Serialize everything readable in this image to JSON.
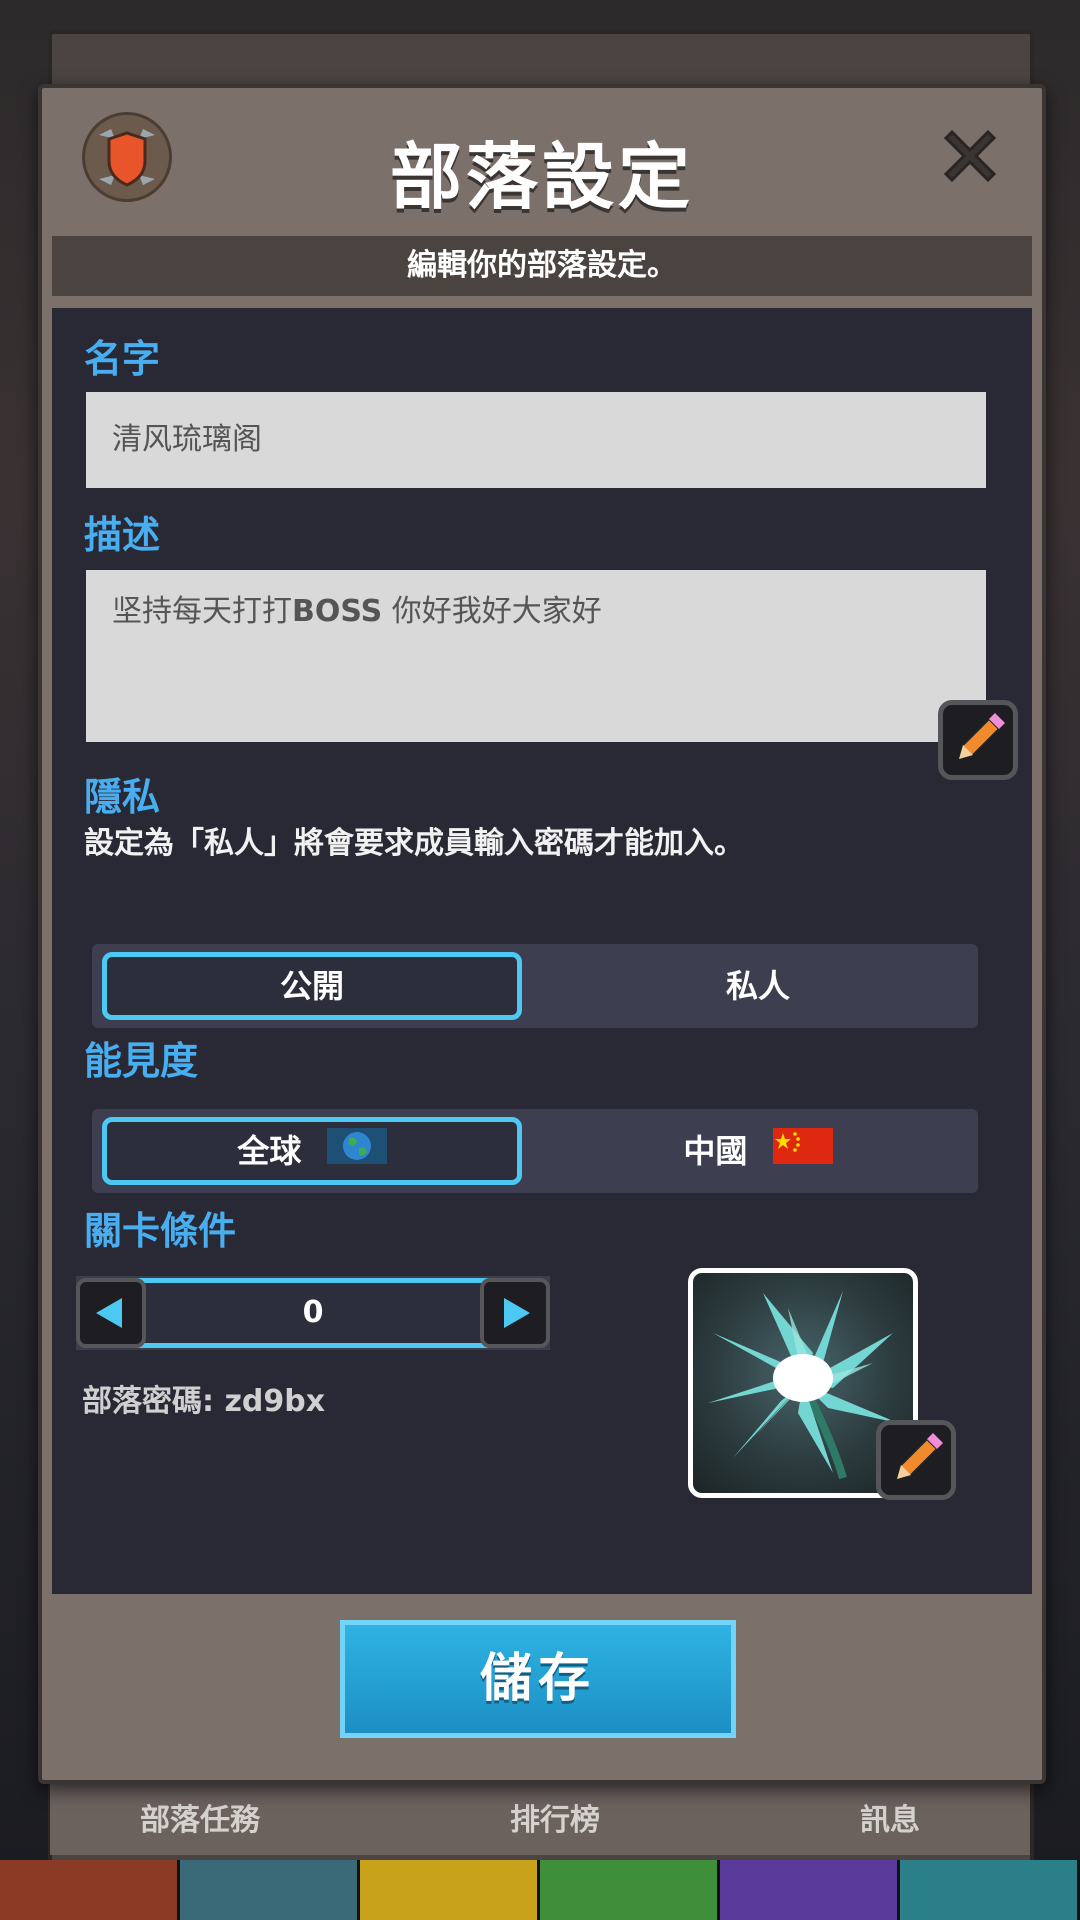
{
  "dialog": {
    "title": "部落設定",
    "subtitle": "編輯你的部落設定。",
    "icons": {
      "badge": "shield-icon",
      "close": "close-icon"
    }
  },
  "name_section": {
    "label": "名字",
    "value": "清风琉璃阁"
  },
  "description_section": {
    "label": "描述",
    "value_prefix": "坚持每天打打",
    "value_bold": "BOSS",
    "value_suffix": " 你好我好大家好",
    "edit_icon": "pencil-icon"
  },
  "privacy_section": {
    "label": "隱私",
    "note": "設定為「私人」將會要求成員輸入密碼才能加入。",
    "options": [
      "公開",
      "私人"
    ],
    "selected": "公開"
  },
  "visibility_section": {
    "label": "能見度",
    "options": [
      {
        "label": "全球",
        "icon": "globe-icon"
      },
      {
        "label": "中國",
        "icon": "china-flag-icon"
      }
    ],
    "selected": "全球"
  },
  "level_section": {
    "label": "關卡條件",
    "value": "0",
    "password_label": "部落密碼: zd9bx"
  },
  "emblem": {
    "icon": "flower-emblem-icon",
    "edit_icon": "pencil-icon"
  },
  "save_label": "儲存",
  "background_tabs": [
    "部落任務",
    "排行榜",
    "訊息"
  ],
  "colors": {
    "accent": "#4cc8f2",
    "label": "#48aef0",
    "panel": "#282935",
    "frame": "#7c716a",
    "save": "#1c9fd2"
  }
}
